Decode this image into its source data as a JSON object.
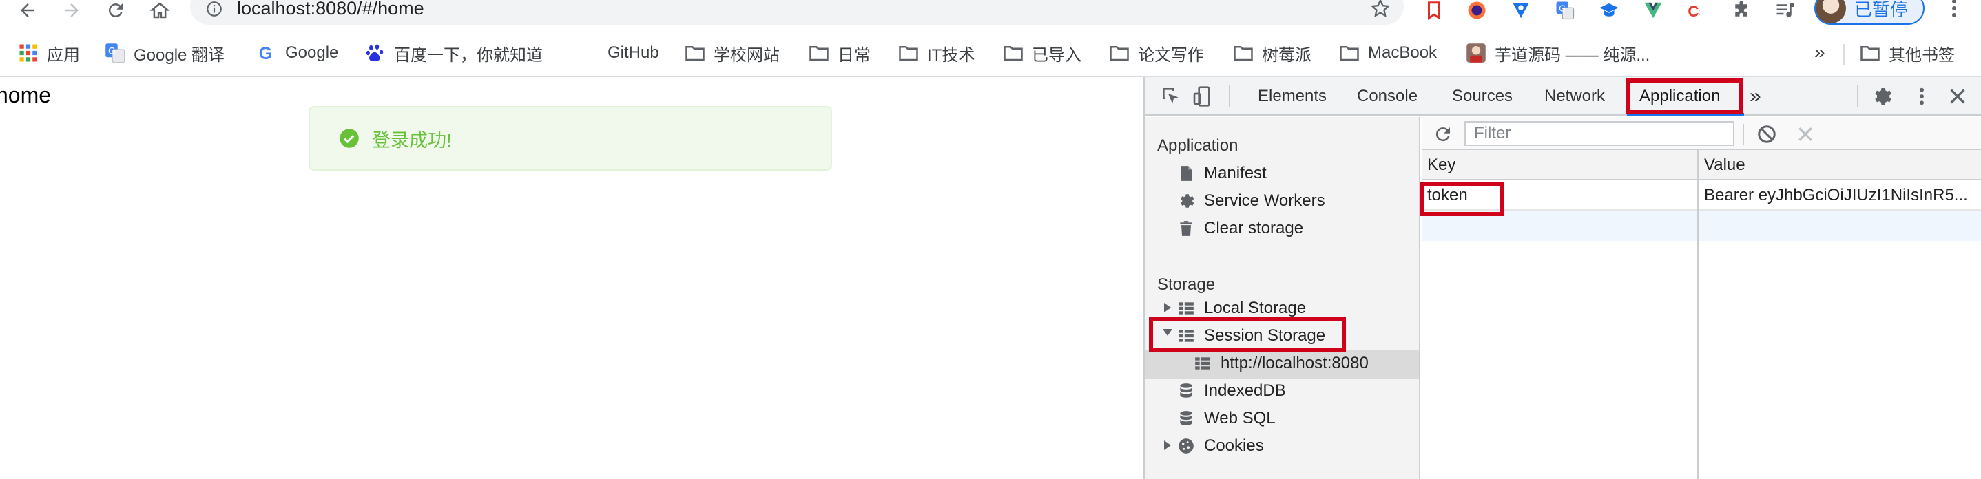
{
  "browser": {
    "url": "localhost:8080/#/home",
    "profile_label": "已暂停"
  },
  "bookmarks": [
    {
      "label": "应用",
      "icon": "apps-grid-icon"
    },
    {
      "label": "Google 翻译",
      "icon": "google-translate-icon"
    },
    {
      "label": "Google",
      "icon": "google-icon"
    },
    {
      "label": "百度一下，你就知道",
      "icon": "baidu-icon"
    },
    {
      "label": "GitHub",
      "icon": "github-icon"
    },
    {
      "label": "学校网站",
      "icon": "folder-icon"
    },
    {
      "label": "日常",
      "icon": "folder-icon"
    },
    {
      "label": "IT技术",
      "icon": "folder-icon"
    },
    {
      "label": "已导入",
      "icon": "folder-icon"
    },
    {
      "label": "论文写作",
      "icon": "folder-icon"
    },
    {
      "label": "树莓派",
      "icon": "folder-icon"
    },
    {
      "label": "MacBook",
      "icon": "folder-icon"
    },
    {
      "label": "芋道源码 —— 纯源...",
      "icon": "site-avatar-icon"
    }
  ],
  "bookmarks_overflow": "»",
  "bookmarks_other": "其他书签",
  "page": {
    "heading": "home",
    "toast_message": "登录成功!"
  },
  "devtools": {
    "tabs": [
      "Elements",
      "Console",
      "Sources",
      "Network",
      "Application"
    ],
    "active_tab": "Application",
    "more_tabs": "»",
    "sidebar": {
      "application_section": "Application",
      "application_items": [
        "Manifest",
        "Service Workers",
        "Clear storage"
      ],
      "storage_section": "Storage",
      "storage_items": {
        "local_storage": "Local Storage",
        "session_storage": "Session Storage",
        "session_origin": "http://localhost:8080",
        "indexeddb": "IndexedDB",
        "websql": "Web SQL",
        "cookies": "Cookies"
      }
    },
    "filter_placeholder": "Filter",
    "table": {
      "columns": [
        "Key",
        "Value"
      ],
      "rows": [
        {
          "key": "token",
          "value": "Bearer eyJhbGciOiJIUzI1NiIsInR5..."
        }
      ]
    }
  },
  "colors": {
    "highlight": "#d0021b",
    "success": "#67c23a",
    "accent": "#1a73e8"
  }
}
